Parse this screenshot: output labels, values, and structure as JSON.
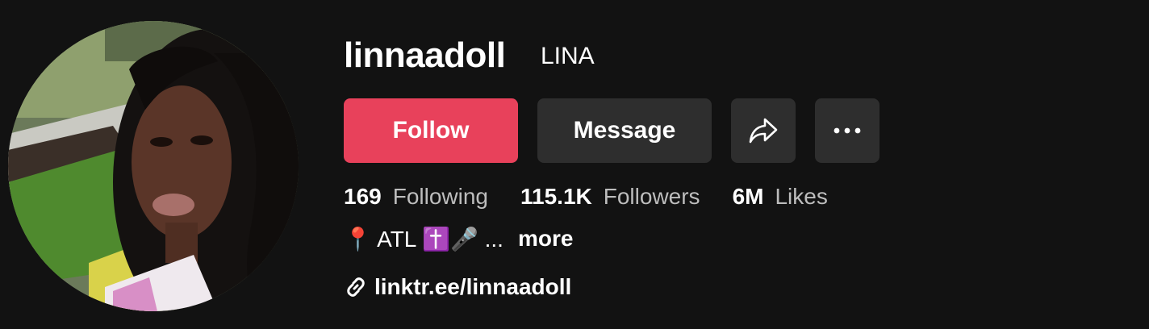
{
  "profile": {
    "username": "linnaadoll",
    "nickname": "LINA",
    "avatar_alt": "profile-photo"
  },
  "actions": {
    "follow_label": "Follow",
    "message_label": "Message",
    "share_icon": "share-arrow-icon",
    "more_icon": "more-dots-icon"
  },
  "stats": {
    "following_value": "169",
    "following_label": "Following",
    "followers_value": "115.1K",
    "followers_label": "Followers",
    "likes_value": "6M",
    "likes_label": "Likes"
  },
  "bio": {
    "text": "📍 ATL ✝️🎤 ...",
    "more_label": "more"
  },
  "link": {
    "icon": "link-icon",
    "text": "linktr.ee/linnaadoll"
  },
  "colors": {
    "background": "#121212",
    "follow_button": "#e8415b",
    "secondary_button": "#2e2e2e",
    "muted_text": "#bdbdbd"
  }
}
